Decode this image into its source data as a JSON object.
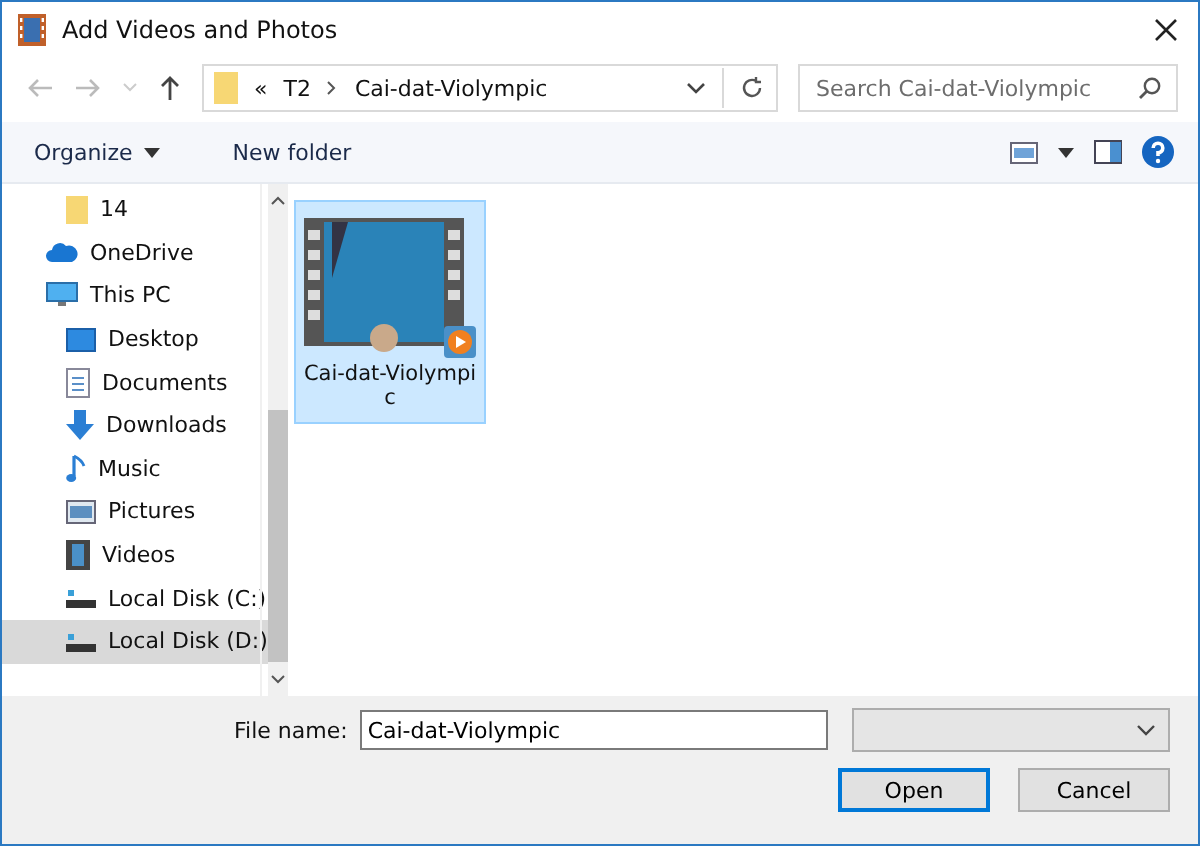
{
  "window": {
    "title": "Add Videos and Photos"
  },
  "address": {
    "path": [
      {
        "label": "T2"
      },
      {
        "label": "Cai-dat-Violympic"
      }
    ],
    "overflow": "«"
  },
  "search": {
    "placeholder": "Search Cai-dat-Violympic"
  },
  "toolbar": {
    "organize": "Organize",
    "new_folder": "New folder"
  },
  "sidebar": {
    "items": [
      {
        "label": "14",
        "kind": "folder",
        "selected": false
      },
      {
        "label": "OneDrive",
        "kind": "cloud",
        "selected": false
      },
      {
        "label": "This PC",
        "kind": "pc",
        "selected": false,
        "children": [
          {
            "label": "Desktop",
            "kind": "desktop",
            "selected": false
          },
          {
            "label": "Documents",
            "kind": "documents",
            "selected": false
          },
          {
            "label": "Downloads",
            "kind": "downloads",
            "selected": false
          },
          {
            "label": "Music",
            "kind": "music",
            "selected": false
          },
          {
            "label": "Pictures",
            "kind": "pictures",
            "selected": false
          },
          {
            "label": "Videos",
            "kind": "videos",
            "selected": false
          },
          {
            "label": "Local Disk (C:)",
            "kind": "drive",
            "selected": false
          },
          {
            "label": "Local Disk (D:)",
            "kind": "drive",
            "selected": true
          }
        ]
      }
    ]
  },
  "files": [
    {
      "name": "Cai-dat-Violympic",
      "selected": true
    }
  ],
  "file_name": {
    "label": "File name:",
    "value": "Cai-dat-Violympic"
  },
  "buttons": [
    {
      "label": "Open",
      "kind": "primary"
    },
    {
      "label": "Cancel",
      "kind": "normal"
    }
  ]
}
